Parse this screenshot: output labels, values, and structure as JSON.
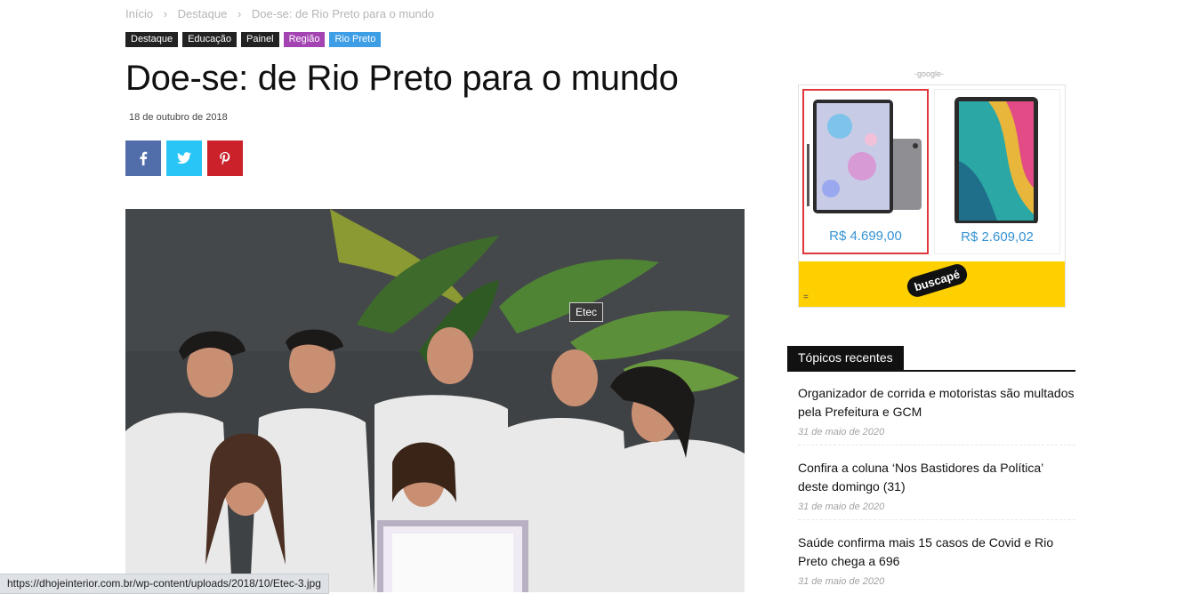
{
  "breadcrumb": {
    "items": [
      "Início",
      "Destaque",
      "Doe-se: de Rio Preto para o mundo"
    ],
    "separator": "›"
  },
  "categories": [
    {
      "label": "Destaque",
      "color": "#222222"
    },
    {
      "label": "Educação",
      "color": "#222222"
    },
    {
      "label": "Painel",
      "color": "#222222"
    },
    {
      "label": "Região",
      "color": "#a444b3"
    },
    {
      "label": "Rio Preto",
      "color": "#3e9ee5"
    }
  ],
  "article": {
    "title": "Doe-se: de Rio Preto para o mundo",
    "date": "18 de outubro de 2018"
  },
  "share": {
    "buttons": [
      {
        "icon": "facebook-icon",
        "color": "#516eab"
      },
      {
        "icon": "twitter-icon",
        "color": "#29c5f6"
      },
      {
        "icon": "pinterest-icon",
        "color": "#ca212a"
      }
    ]
  },
  "photo": {
    "tooltip": "Etec"
  },
  "ad": {
    "label": "-google-",
    "products": [
      {
        "price": "R$ 4.699,00"
      },
      {
        "price": "R$ 2.609,02"
      }
    ],
    "brand": "buscapé",
    "menu_glyph": "="
  },
  "sidebar": {
    "heading": "Tópicos recentes",
    "posts": [
      {
        "title": "Organizador de corrida e motoristas são multados pela Prefeitura e GCM",
        "date": "31 de maio de 2020"
      },
      {
        "title": "Confira a coluna ‘Nos Bastidores da Política’ deste domingo (31)",
        "date": "31 de maio de 2020"
      },
      {
        "title": "Saúde confirma mais 15 casos de Covid e Rio Preto chega a 696",
        "date": "31 de maio de 2020"
      }
    ]
  },
  "statusbar": {
    "url": "https://dhojeinterior.com.br/wp-content/uploads/2018/10/Etec-3.jpg"
  }
}
